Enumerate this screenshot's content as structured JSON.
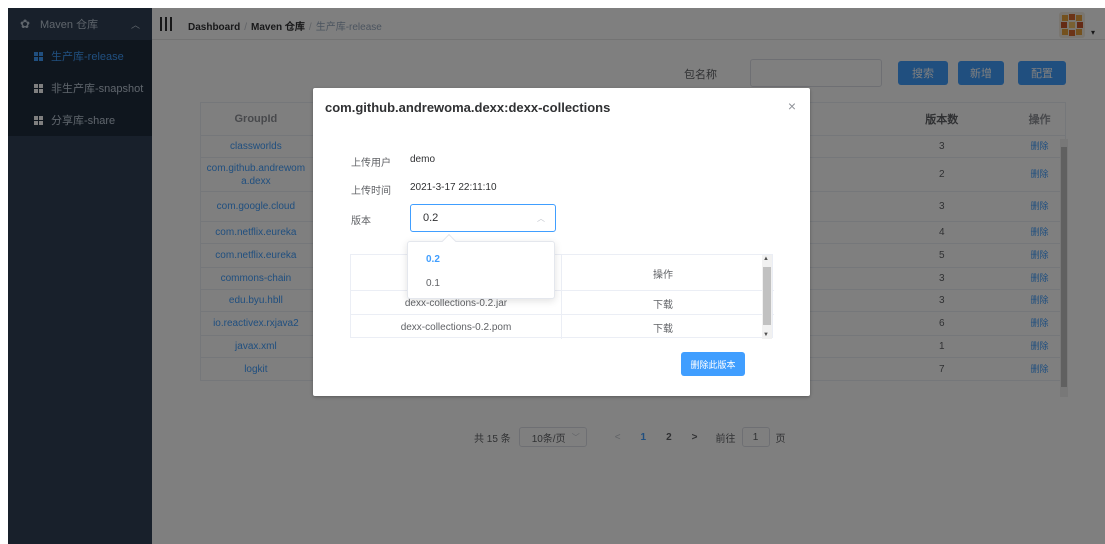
{
  "sidebar": {
    "menu_title": "Maven 仓库",
    "items": [
      {
        "label": "生产库-release",
        "active": true
      },
      {
        "label": "非生产库-snapshot",
        "active": false
      },
      {
        "label": "分享库-share",
        "active": false
      }
    ]
  },
  "topbar": {
    "crumb_1": "Dashboard",
    "crumb_2": "Maven 仓库",
    "crumb_3": "生产库-release",
    "separator": "/"
  },
  "search": {
    "label": "包名称",
    "value": "",
    "search_btn": "搜索",
    "add_btn": "新增",
    "config_btn": "配置"
  },
  "table": {
    "headers": [
      "GroupId",
      "",
      "版本数",
      "操作"
    ],
    "rows": [
      {
        "group": "classworlds",
        "versions": "3",
        "action": "删除"
      },
      {
        "group": "com.github.andrewoma.dexx",
        "versions": "2",
        "action": "删除"
      },
      {
        "group": "com.google.cloud",
        "versions": "3",
        "action": "删除"
      },
      {
        "group": "com.netflix.eureka",
        "versions": "4",
        "action": "删除"
      },
      {
        "group": "com.netflix.eureka",
        "versions": "5",
        "action": "删除"
      },
      {
        "group": "commons-chain",
        "versions": "3",
        "action": "删除"
      },
      {
        "group": "edu.byu.hbll",
        "versions": "3",
        "action": "删除"
      },
      {
        "group": "io.reactivex.rxjava2",
        "versions": "6",
        "action": "删除"
      },
      {
        "group": "javax.xml",
        "versions": "1",
        "action": "删除"
      },
      {
        "group": "logkit",
        "versions": "7",
        "action": "删除"
      }
    ]
  },
  "pagination": {
    "total": "共 15 条",
    "page_size": "10条/页",
    "prev": "<",
    "page_1": "1",
    "page_2": "2",
    "next": ">",
    "goto_label": "前往",
    "goto_value": "1",
    "goto_unit": "页"
  },
  "dialog": {
    "title": "com.github.andrewoma.dexx:dexx-collections",
    "close": "×",
    "uploader_label": "上传用户",
    "uploader_value": "demo",
    "upload_time_label": "上传时间",
    "upload_time_value": "2021-3-17 22:11:10",
    "version_label": "版本",
    "version_value": "0.2",
    "file_header_action": "操作",
    "files": [
      {
        "name": "dexx-collections-0.2.jar",
        "action": "下载"
      },
      {
        "name": "dexx-collections-0.2.pom",
        "action": "下载"
      }
    ],
    "delete_version_btn": "删除此版本"
  },
  "version_dropdown": {
    "options": [
      "0.2",
      "0.1"
    ],
    "selected": "0.2"
  },
  "colors": {
    "primary": "#409eff",
    "sidebar_bg": "#304156",
    "submenu_bg": "#1f2d3d"
  }
}
